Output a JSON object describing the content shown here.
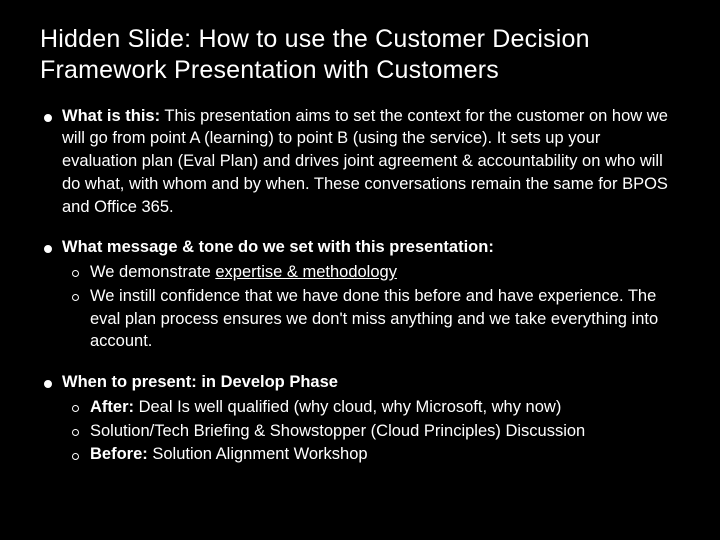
{
  "title": "Hidden Slide: How to use the Customer Decision Framework Presentation with Customers",
  "b1": {
    "label": "What is this:",
    "text": " This presentation aims to set the context for the customer on how we will go from point A (learning) to point B (using the service). It sets up your evaluation plan (Eval Plan) and drives joint agreement & accountability on who will do what, with whom and by when. These conversations remain the same for BPOS and Office 365."
  },
  "b2": {
    "label": "What message & tone do we set with this presentation:",
    "s1_pre": "We demonstrate ",
    "s1_u": "expertise & methodology",
    "s2": "We instill confidence that we have done this before and have experience. The eval plan process ensures we don't miss anything and we take everything into account."
  },
  "b3": {
    "label": "When to present: in Develop Phase",
    "s1_b": "After:",
    "s1_t": " Deal Is well qualified (why cloud, why Microsoft, why now)",
    "s2": "Solution/Tech Briefing & Showstopper (Cloud Principles) Discussion",
    "s3_b": "Before:",
    "s3_t": " Solution Alignment Workshop"
  }
}
